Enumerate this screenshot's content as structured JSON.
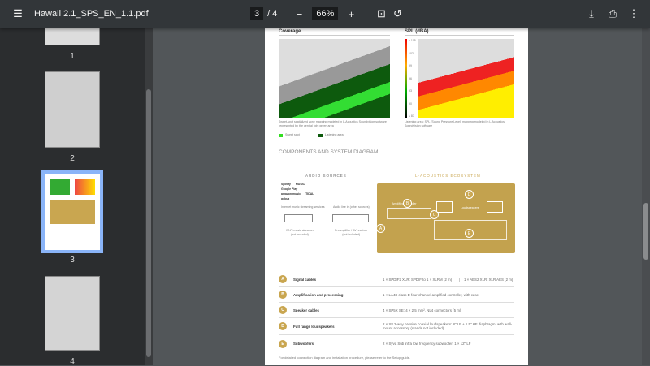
{
  "toolbar": {
    "title": "Hawaii 2.1_SPS_EN_1.1.pdf",
    "current_page": "3",
    "total_pages": "/ 4",
    "zoom": "66%"
  },
  "sidebar": {
    "thumbnails": [
      {
        "label": "1"
      },
      {
        "label": "2"
      },
      {
        "label": "3",
        "selected": true
      },
      {
        "label": "4"
      }
    ]
  },
  "document": {
    "coverage": {
      "title": "Coverage",
      "caption": "Sweet-spot spatialized zone mapping modeled in L-Acoustics Soundvision software represented by the central light green area",
      "legend": [
        {
          "label": "Sweet spot",
          "color": "#33dd22"
        },
        {
          "label": "Listening area",
          "color": "#0d5a0d"
        }
      ]
    },
    "spl": {
      "title": "SPL (dBA)",
      "caption": "Listening area: SPL (Sound Pressure Level) mapping modeled in L-Acoustics Soundvision software",
      "scale": [
        "≥ 105",
        "102",
        "99",
        "96",
        "93",
        "90",
        "≤ 87"
      ]
    },
    "section_title": "COMPONENTS AND SYSTEM DIAGRAM",
    "diagram": {
      "audio_sources": "AUDIO SOURCES",
      "ecosystem": "L-ACOUSTICS ECOSYSTEM",
      "services": [
        "Spotify",
        "MUSIC",
        "Google Play",
        "amazon music",
        "TIDAL",
        "qobuz"
      ],
      "streaming_label": "Internet music streaming services",
      "line_in_label": "Audio line in (other sources)",
      "streamer": "Wi-Fi music streamer\n(not included)",
      "preamp": "Preamplifier / AV receiver\n(not included)",
      "controller": "Amplified controller",
      "loudspeakers": "Loudspeakers",
      "markers": [
        "A",
        "B",
        "C",
        "D",
        "E"
      ]
    },
    "components": [
      {
        "letter": "A",
        "name": "Signal cables",
        "value": "1 × SPDIF2 XLR: SPDIF to 1 × XLRM (2 m)",
        "value2": "1 × AES2 XLR: XLR AES (2 m)"
      },
      {
        "letter": "B",
        "name": "Amplification and processing",
        "value": "1 × LA4X class D four-channel amplified controller, with case"
      },
      {
        "letter": "C",
        "name": "Speaker cables",
        "value": "4 × SP5X SE: 4 × 2.5 mm², NL4 connectors (5 m)"
      },
      {
        "letter": "D",
        "name": "Full range loudspeakers",
        "value": "2 × X8 2-way passive coaxial loudspeakers: 8\" LF + 1.5\" HF diaphragm, with wall-mount accessory (stands not included)"
      },
      {
        "letter": "E",
        "name": "Subwoofers",
        "value": "2 × Syva Sub infra low frequency subwoofer: 1 × 12\" LF"
      }
    ],
    "footer_note": "For detailed connection diagram and installation procedure, please refer to the Setup guide."
  }
}
